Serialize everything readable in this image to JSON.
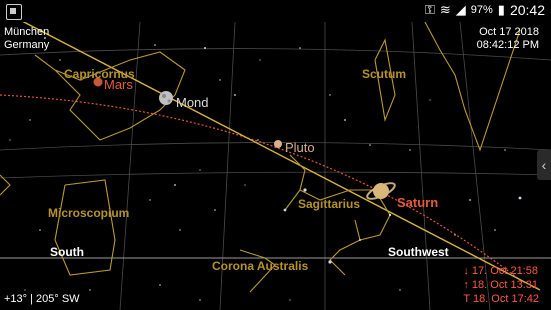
{
  "status_bar": {
    "battery": "97%",
    "clock": "20:42"
  },
  "location": {
    "city": "München",
    "country": "Germany"
  },
  "datetime": {
    "date": "Oct 17 2018",
    "time": "08:42:12 PM"
  },
  "view": {
    "altitude_azimuth": "+13° | 205° SW"
  },
  "directions": {
    "south": "South",
    "southwest": "Southwest"
  },
  "constellations": {
    "capricornus": "Capricornus",
    "scutum": "Scutum",
    "microscopium": "Microscopium",
    "sagittarius": "Sagittarius",
    "corona_australis": "Corona Australis"
  },
  "bodies": {
    "mars": "Mars",
    "moon": "Mond",
    "pluto": "Pluto",
    "saturn": "Saturn"
  },
  "saturn_events": {
    "set": "↓ 17. Oct 21:58",
    "rise": "↑ 18. Oct 13:31",
    "transit": "T 18. Oct 17:42"
  },
  "colors": {
    "constellation_line": "#b99a2e",
    "constellation_label": "#b6932a",
    "planet_label": "#e65a3c",
    "moon_label": "#d9d9d9",
    "grid": "#4a4a4a",
    "ecliptic": "#e0553a",
    "horizon": "#9a9a9a",
    "rise_set_text": "#ff5a43"
  },
  "icons": {
    "collapse": "chevron-left-icon",
    "notification": "image-icon",
    "wifi": "wifi-icon",
    "signal": "signal-icon",
    "battery": "battery-icon",
    "key": "key-icon"
  }
}
